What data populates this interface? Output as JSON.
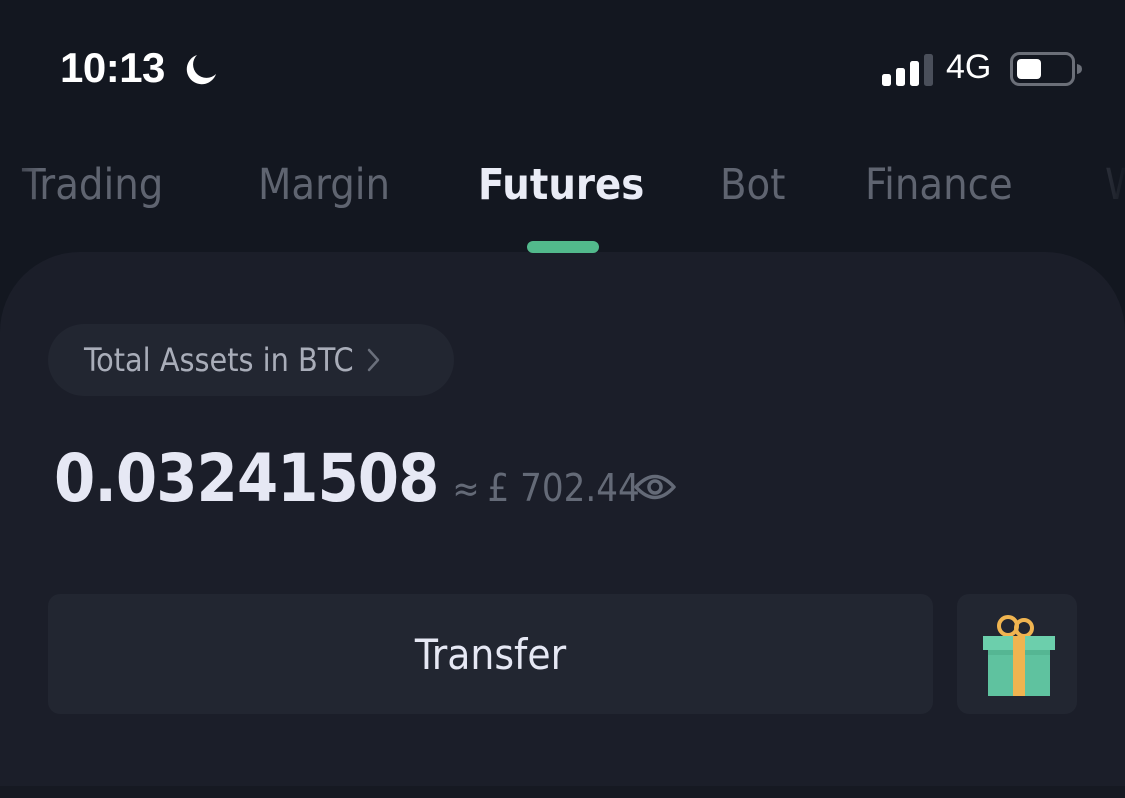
{
  "status_bar": {
    "time": "10:13",
    "focus_icon": "moon-icon",
    "signal_icon": "cellular-signal-icon",
    "signal_bars_filled": 3,
    "signal_bars_total": 4,
    "network": "4G",
    "battery_icon": "battery-icon",
    "battery_level_fraction": 0.4
  },
  "tabs": {
    "items": [
      {
        "label": "Trading",
        "active": false
      },
      {
        "label": "Margin",
        "active": false
      },
      {
        "label": "Futures",
        "active": true
      },
      {
        "label": "Bot",
        "active": false
      },
      {
        "label": "Finance",
        "active": false
      },
      {
        "label": "W",
        "active": false
      }
    ],
    "indicator_color": "#52b98c"
  },
  "assets": {
    "label": "Total Assets in BTC",
    "label_icon": "chevron-right-icon",
    "btc_value": "0.03241508",
    "approx_symbol": "≈",
    "fiat_value": "£ 702.44",
    "visibility_icon": "eye-icon"
  },
  "actions": {
    "transfer_label": "Transfer",
    "gift_icon": "gift-icon"
  },
  "colors": {
    "background": "#131720",
    "card": "#1b1e29",
    "accent": "#52b98c",
    "gift_box": "#6ccfac",
    "gift_ribbon": "#f0b450"
  }
}
